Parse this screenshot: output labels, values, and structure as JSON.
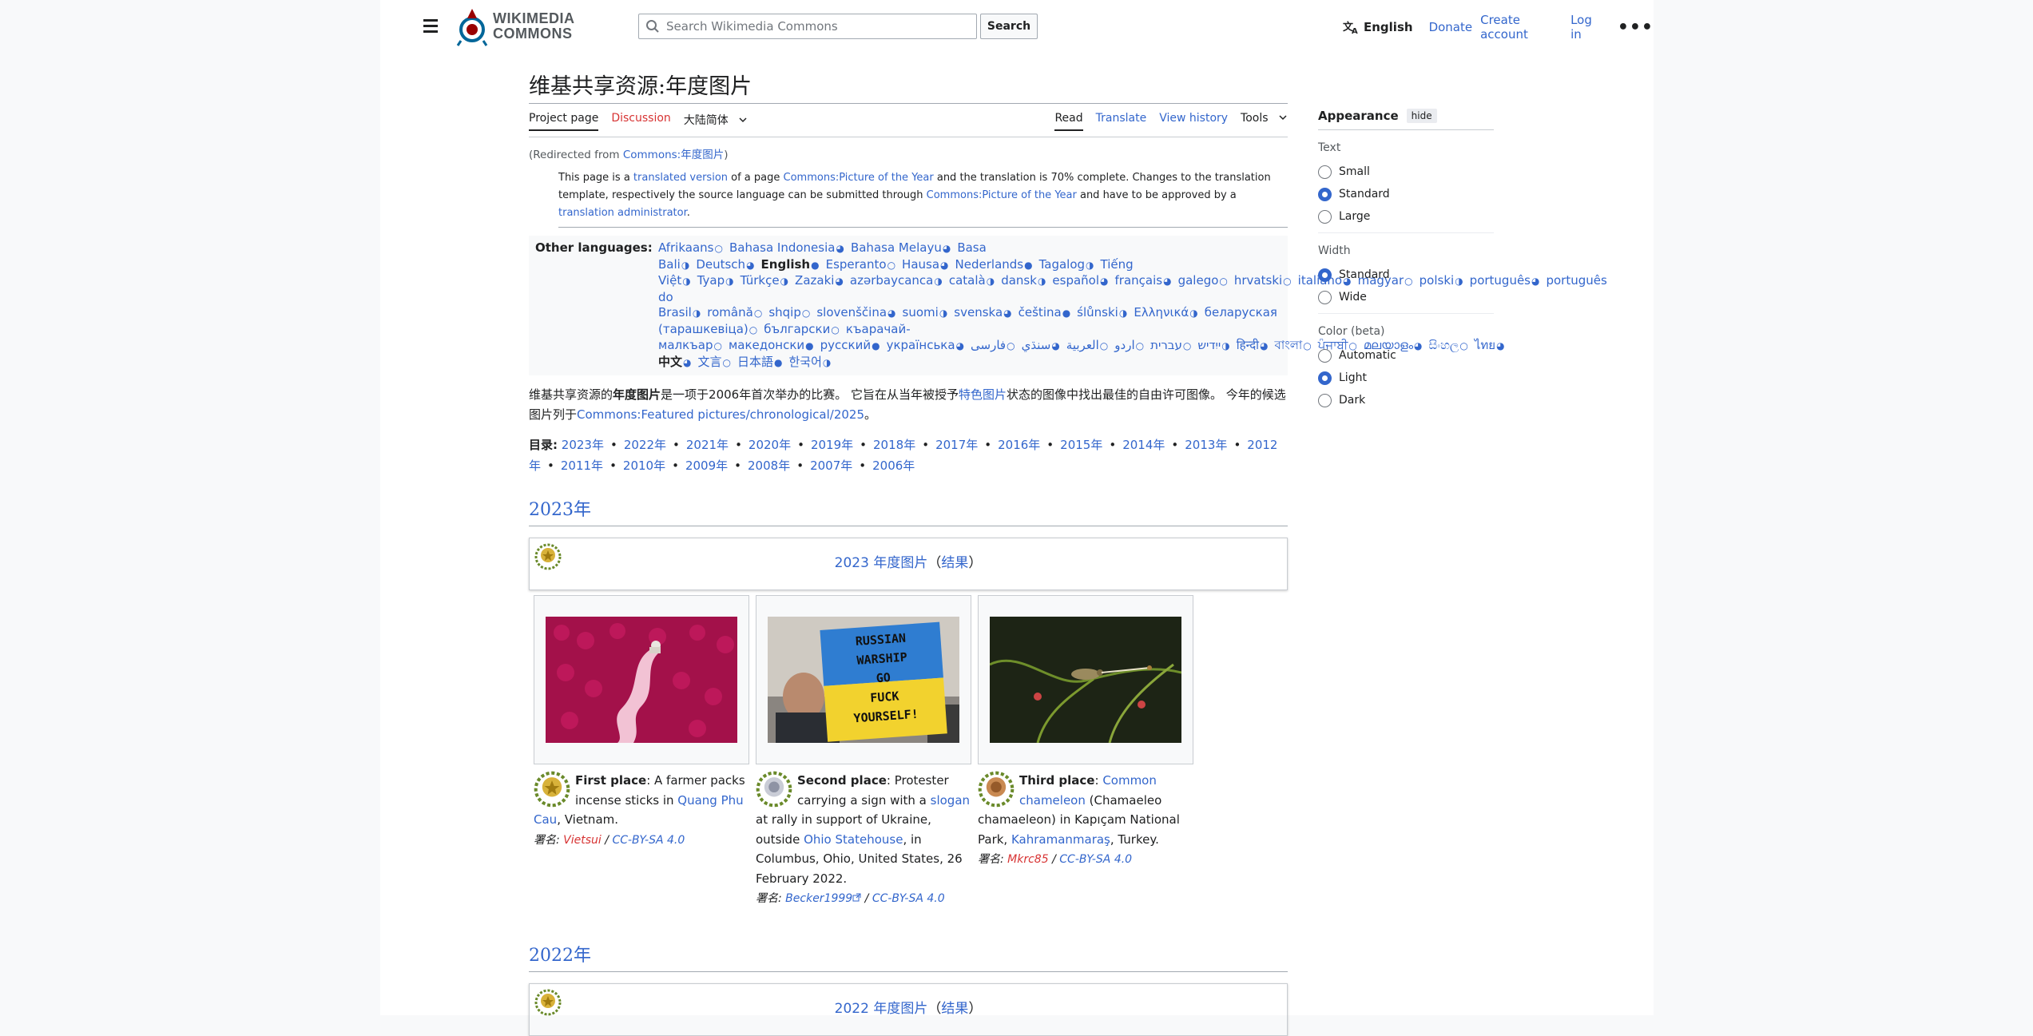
{
  "header": {
    "logo_line1": "WIKIMEDIA",
    "logo_line2": "COMMONS",
    "search_placeholder": "Search Wikimedia Commons",
    "search_button": "Search",
    "language": "English",
    "donate": "Donate",
    "create_account": "Create account",
    "login": "Log in",
    "more": "•••"
  },
  "page": {
    "title": "维基共享资源:年度图片",
    "tabs_left": [
      "Project page",
      "Discussion",
      "大陆简体"
    ],
    "tabs_right": [
      "Read",
      "Translate",
      "View history",
      "Tools"
    ],
    "redirect_prefix": "(Redirected from ",
    "redirect_link": "Commons:年度图片",
    "redirect_suffix": ")",
    "notice": {
      "p1": "This page is a ",
      "l1": "translated version",
      "p2": " of a page ",
      "l2": "Commons:Picture of the Year",
      "p3": " and the translation is 70% complete. Changes to the translation template, respectively the source language can be submitted through ",
      "l3": "Commons:Picture of the Year",
      "p4": " and have to be approved by a ",
      "l4": "translation administrator",
      "p5": "."
    },
    "other_languages_label": "Other languages:",
    "languages": [
      "Afrikaans",
      "Bahasa Indonesia",
      "Bahasa Melayu",
      "Basa Bali",
      "Deutsch",
      "English",
      "Esperanto",
      "Hausa",
      "Nederlands",
      "Tagalog",
      "Tiếng Việt",
      "Tyap",
      "Türkçe",
      "Zazaki",
      "azərbaycanca",
      "català",
      "dansk",
      "español",
      "français",
      "galego",
      "hrvatski",
      "italiano",
      "magyar",
      "polski",
      "português",
      "português do Brasil",
      "română",
      "shqip",
      "slovenščina",
      "suomi",
      "svenska",
      "čeština",
      "ślůnski",
      "Ελληνικά",
      "беларуская (тарашкевіца)",
      "български",
      "къарачай-малкъар",
      "македонски",
      "русский",
      "українська",
      "ייִדיש",
      "עברית",
      "اردو",
      "العربية",
      "سنڌي",
      "فارسی",
      "हिन्दी",
      "বাংলা",
      "ਪੰਜਾਬੀ",
      "മലയാളം",
      "සිංහල",
      "ไทย",
      "中文",
      "文言",
      "日本語",
      "한국어"
    ],
    "intro": {
      "p1": "维基共享资源的",
      "b1": "年度图片",
      "p2": "是一项于2006年首次举办的比赛。 它旨在从当年被授予",
      "l1": "特色图片",
      "p3": "状态的图像中找出最佳的自由许可图像。 今年的候选图片列于",
      "l2": "Commons:Featured pictures/chronological/2025",
      "p4": "。"
    },
    "toc_label": "目录:",
    "toc_years": [
      "2023年",
      "2022年",
      "2021年",
      "2020年",
      "2019年",
      "2018年",
      "2017年",
      "2016年",
      "2015年",
      "2014年",
      "2013年",
      "2012年",
      "2011年",
      "2010年",
      "2009年",
      "2008年",
      "2007年",
      "2006年"
    ]
  },
  "sections": {
    "y2023": {
      "heading": "2023年",
      "box_title": "2023 年度图片",
      "box_open": "（",
      "box_link": "结果",
      "box_close": "）",
      "first": {
        "place": "First place",
        "t1": ": A farmer packs incense sticks in ",
        "l1": "Quang Phu Cau",
        "t2": ", Vietnam.",
        "credit_prefix": "署名: ",
        "author": "Vietsui",
        "slash": " / ",
        "license": "CC-BY-SA 4.0"
      },
      "second": {
        "place": "Second place",
        "t1": ": Protester carrying a sign with a ",
        "l1": "slogan",
        "t2": " at rally in support of Ukraine, outside ",
        "l2": "Ohio Statehouse",
        "t3": ", in Columbus, Ohio, United States, 26 February 2022.",
        "credit_prefix": "署名: ",
        "author": "Becker1999",
        "slash": " / ",
        "license": "CC-BY-SA 4.0",
        "sign_lines": [
          "RUSSIAN",
          "WARSHIP",
          "GO",
          "FUCK",
          "YOURSELF!"
        ]
      },
      "third": {
        "place": "Third place",
        "t0": ": ",
        "l1": "Common chameleon",
        "t1": " (Chamaeleo chamaeleon) in Kapıçam National Park, ",
        "l2": "Kahramanmaraş",
        "t2": ", Turkey.",
        "credit_prefix": "署名: ",
        "author": "Mkrc85",
        "slash": " / ",
        "license": "CC-BY-SA 4.0"
      }
    },
    "y2022": {
      "heading": "2022年",
      "box_title": "2022 年度图片",
      "box_open": "（",
      "box_link": "结果",
      "box_close": "）"
    }
  },
  "appearance": {
    "title": "Appearance",
    "hide": "hide",
    "text_label": "Text",
    "text_options": [
      "Small",
      "Standard",
      "Large"
    ],
    "text_selected": "Standard",
    "width_label": "Width",
    "width_options": [
      "Standard",
      "Wide"
    ],
    "width_selected": "Standard",
    "color_label": "Color (beta)",
    "color_options": [
      "Automatic",
      "Light",
      "Dark"
    ],
    "color_selected": "Light"
  },
  "colors": {
    "link": "#3366cc",
    "red_link": "#d73333",
    "accent": "#3366cc"
  }
}
